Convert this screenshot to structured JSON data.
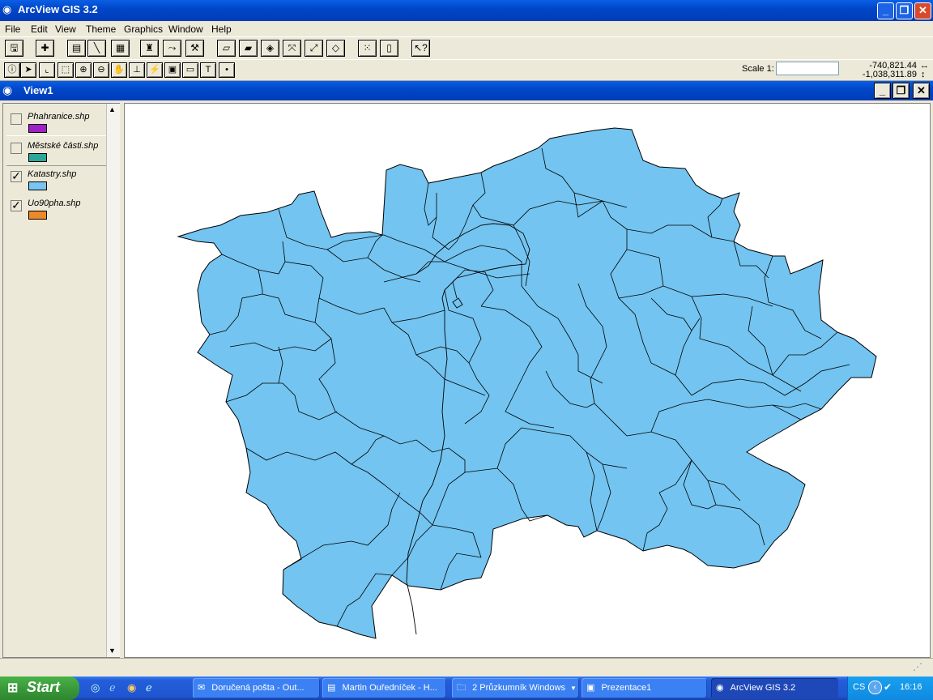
{
  "app": {
    "title": "ArcView GIS 3.2"
  },
  "menu": [
    "File",
    "Edit",
    "View",
    "Theme",
    "Graphics",
    "Window",
    "Help"
  ],
  "toolbar": {
    "scale_label": "Scale 1:",
    "scale_value": "",
    "x_coord": "-740,821.44",
    "y_coord": "-1,038,311.89"
  },
  "view": {
    "title": "View1",
    "layers": [
      {
        "name": "Phahranice.shp",
        "checked": false,
        "color": "#a020c8"
      },
      {
        "name": "Městské části.shp",
        "checked": false,
        "color": "#2aa79a"
      },
      {
        "name": "Katastry.shp",
        "checked": true,
        "color": "#79c4f0"
      },
      {
        "name": "Uo90pha.shp",
        "checked": true,
        "color": "#ec8a2a"
      }
    ],
    "map_fill": "#73c4f0"
  },
  "taskbar": {
    "start": "Start",
    "tasks": [
      "Doručená pošta - Out...",
      "Martin Ouředníček - H...",
      "2 Průzkumník Windows",
      "Prezentace1",
      "ArcView GIS 3.2"
    ],
    "lang": "CS",
    "time": "16:16"
  }
}
